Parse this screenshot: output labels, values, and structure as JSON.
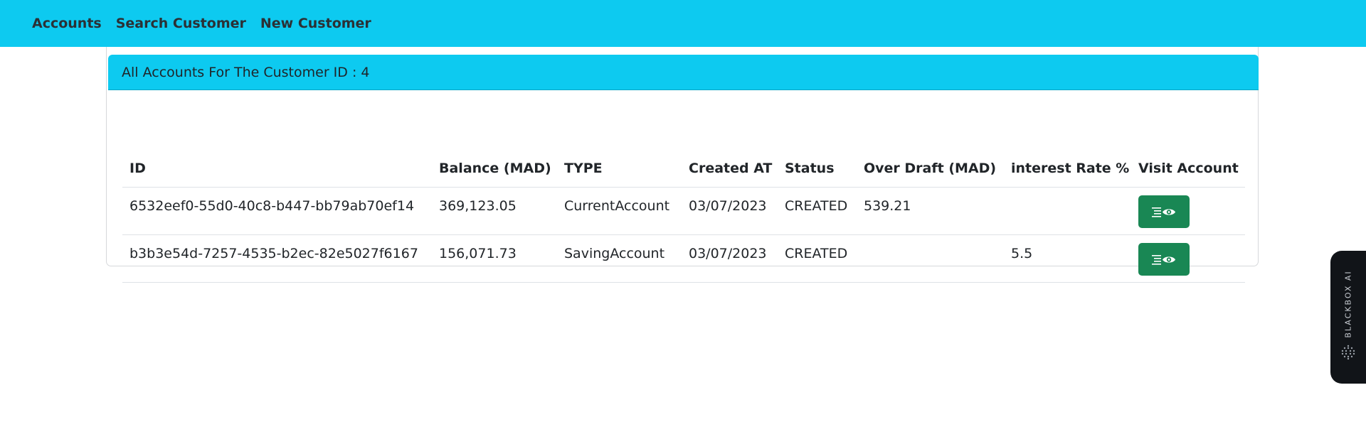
{
  "nav": {
    "items": [
      {
        "label": "Accounts"
      },
      {
        "label": "Search Customer"
      },
      {
        "label": "New Customer"
      }
    ]
  },
  "card": {
    "title": "All Accounts For The Customer ID : 4"
  },
  "table": {
    "headers": [
      "ID",
      "Balance (MAD)",
      "TYPE",
      "Created AT",
      "Status",
      "Over Draft (MAD)",
      "interest Rate %",
      "Visit Account"
    ],
    "rows": [
      {
        "id": "6532eef0-55d0-40c8-b447-bb79ab70ef14",
        "balance": "369,123.05",
        "type": "CurrentAccount",
        "created_at": "03/07/2023",
        "status": "CREATED",
        "over_draft": "539.21",
        "interest_rate": "",
        "visit_icon": "list-eye-icon"
      },
      {
        "id": "b3b3e54d-7257-4535-b2ec-82e5027f6167",
        "balance": "156,071.73",
        "type": "SavingAccount",
        "created_at": "03/07/2023",
        "status": "CREATED",
        "over_draft": "",
        "interest_rate": "5.5",
        "visit_icon": "list-eye-icon"
      }
    ]
  },
  "side_widget": {
    "label": "BLACKBOX AI",
    "icon": "dot-grid-logo-icon"
  },
  "colors": {
    "navbar": "#0dcaf0",
    "card_header": "#0dcaf0",
    "visit_button": "#198754",
    "side_widget": "#111418"
  }
}
